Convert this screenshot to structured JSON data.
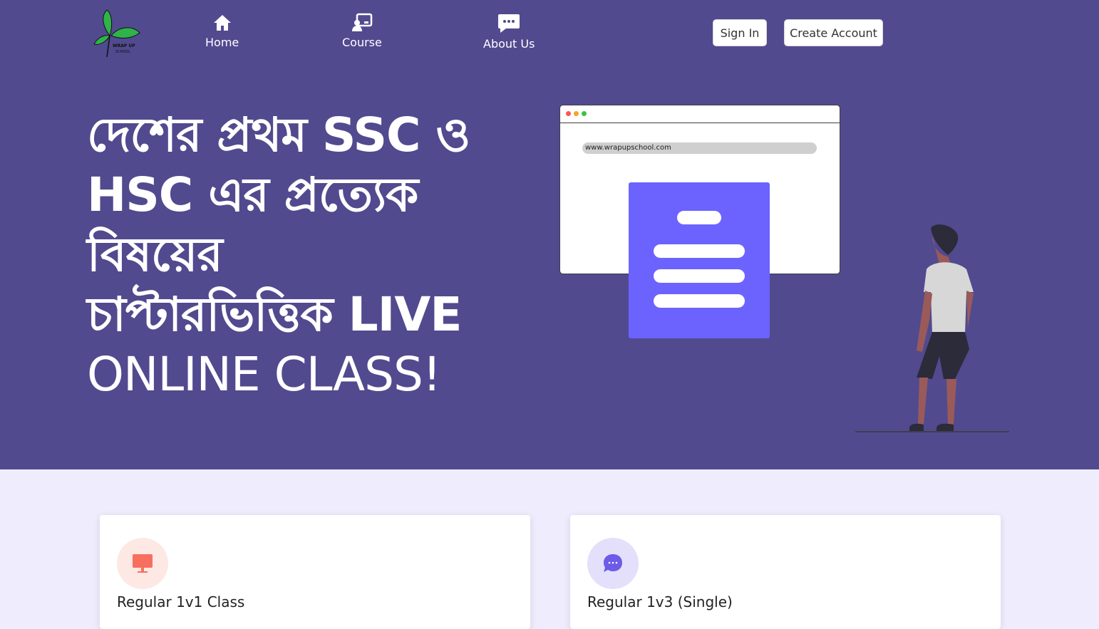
{
  "logo": {
    "name": "WRAP UP SCHOOL",
    "line1": "WRAP UP",
    "line2": "SCHOOL"
  },
  "nav": [
    {
      "label": "Home",
      "icon": "home-icon"
    },
    {
      "label": "Course",
      "icon": "course-icon"
    },
    {
      "label": "About Us",
      "icon": "chat-icon"
    }
  ],
  "auth": {
    "sign_in": "Sign In",
    "create_account": "Create Account"
  },
  "hero": {
    "line1": "দেশের প্রথম SSC ও",
    "line2": "HSC এর প্রত্যেক",
    "line3": "বিষয়ের",
    "line4": "চাপ্টারভিত্তিক LIVE",
    "line5": "ONLINE CLASS!",
    "browser_url": "www.wrapupschool.com"
  },
  "cards": [
    {
      "title": "Regular 1v1 Class",
      "icon": "monitor-icon",
      "icon_bg": "#fde8e4",
      "icon_color": "#f76f5f"
    },
    {
      "title": "Regular 1v3 (Single)",
      "icon": "chat-bubble-icon",
      "icon_bg": "#e4e0fb",
      "icon_color": "#6c5ce7"
    }
  ],
  "colors": {
    "hero_bg": "#514a8f",
    "page_bg": "#efedfd",
    "accent": "#6c63ff"
  }
}
